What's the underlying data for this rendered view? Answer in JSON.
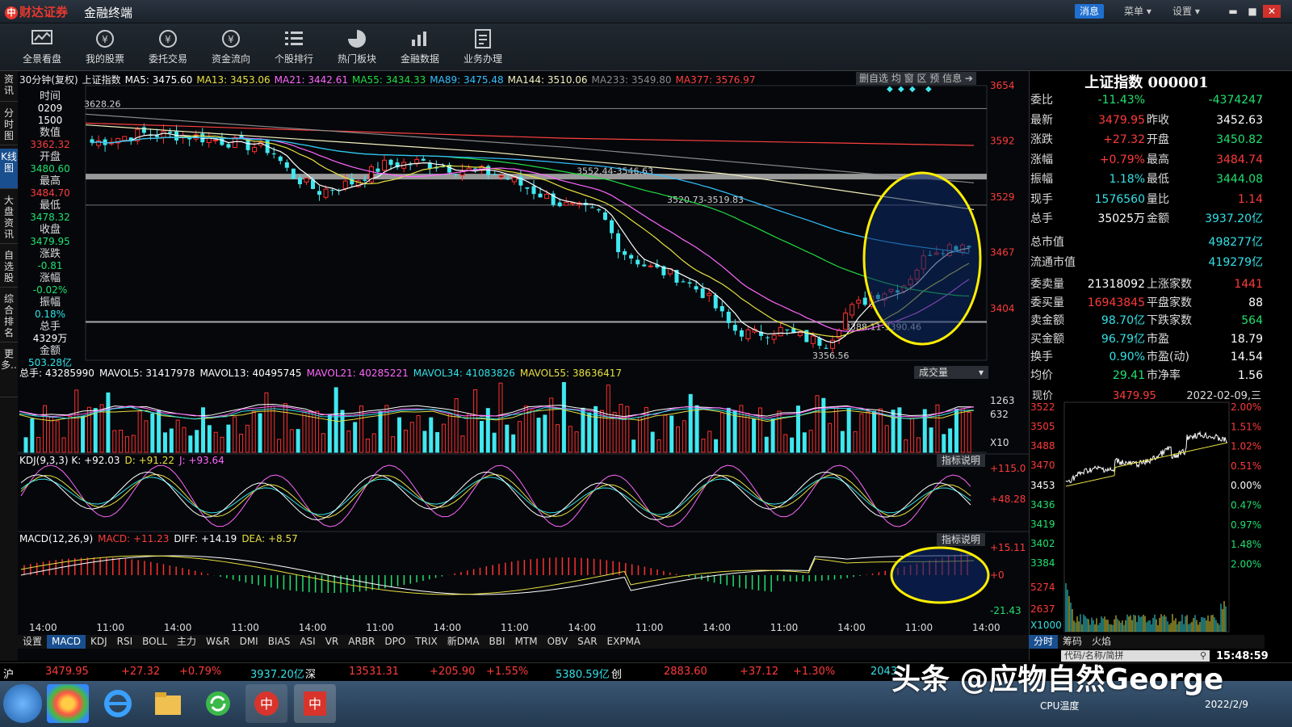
{
  "app": {
    "brand": "财达证券",
    "name": "金融终端",
    "messages": "消息",
    "menu": "菜单",
    "settings": "设置"
  },
  "toolbar": [
    "全景看盘",
    "我的股票",
    "委托交易",
    "资金流向",
    "个股排行",
    "热门板块",
    "金融数据",
    "业务办理"
  ],
  "left_tabs": [
    "资讯",
    "分时图",
    "K线图",
    "大盘资讯",
    "自选股",
    "综合排名",
    "更多.."
  ],
  "chart_header": {
    "period": "30分钟(复权)",
    "name": "上证指数",
    "ma": [
      {
        "label": "MA5: 3475.60",
        "color": "#ffffff"
      },
      {
        "label": "MA13: 3453.06",
        "color": "#e8e040"
      },
      {
        "label": "MA21: 3442.61",
        "color": "#ff66ff"
      },
      {
        "label": "MA55: 3434.33",
        "color": "#22dd44"
      },
      {
        "label": "MA89: 3475.48",
        "color": "#33c0ff"
      },
      {
        "label": "MA144: 3510.06",
        "color": "#f5f0c0"
      },
      {
        "label": "MA233: 3549.80",
        "color": "#8a8a8a"
      },
      {
        "label": "MA377: 3576.97",
        "color": "#ff4040"
      }
    ],
    "tools": "删自选 均 窗 区 预 信息"
  },
  "info_column": [
    {
      "label": "时间",
      "value": "0209",
      "vcolor": "#ffffff"
    },
    {
      "label": "",
      "value": "1500",
      "vcolor": "#ffffff"
    },
    {
      "label": "数值",
      "value": "3362.32",
      "vcolor": "#ff3b3b"
    },
    {
      "label": "开盘",
      "value": "3480.60",
      "vcolor": "#20e070"
    },
    {
      "label": "最高",
      "value": "3484.70",
      "vcolor": "#ff3b3b"
    },
    {
      "label": "最低",
      "value": "3478.32",
      "vcolor": "#20e070"
    },
    {
      "label": "收盘",
      "value": "3479.95",
      "vcolor": "#20e070"
    },
    {
      "label": "涨跌",
      "value": "-0.81",
      "vcolor": "#20e070"
    },
    {
      "label": "涨幅",
      "value": "-0.02%",
      "vcolor": "#20e070"
    },
    {
      "label": "振幅",
      "value": "0.18%",
      "vcolor": "#33e0e6"
    },
    {
      "label": "总手",
      "value": "4329万",
      "vcolor": "#ffffff"
    },
    {
      "label": "金额",
      "value": "503.28亿",
      "vcolor": "#33e0e6"
    }
  ],
  "kline": {
    "y_ticks": [
      "3654",
      "3592",
      "3529",
      "3467",
      "3404"
    ],
    "y_values": [
      3654,
      3592,
      3529,
      3467,
      3404
    ],
    "annotations": [
      {
        "text": "3628.26"
      },
      {
        "text": "3552.44-3546.63"
      },
      {
        "text": "3520.73-3519.83"
      },
      {
        "text": "3388.11-3390.46"
      },
      {
        "text": "3356.56"
      }
    ]
  },
  "volume": {
    "header": [
      {
        "label": "总手: 43285990",
        "color": "#ffffff"
      },
      {
        "label": "MAVOL5: 31417978",
        "color": "#ffffff"
      },
      {
        "label": "MAVOL13: 40495745",
        "color": "#ffffff"
      },
      {
        "label": "MAVOL21: 40285221",
        "color": "#ff66ff"
      },
      {
        "label": "MAVOL34: 41083826",
        "color": "#33e0e6"
      },
      {
        "label": "MAVOL55: 38636417",
        "color": "#e8e040"
      }
    ],
    "button": "成交量",
    "y_ticks": [
      "1263",
      "632",
      "X10"
    ]
  },
  "kdj": {
    "header": [
      {
        "label": "KDJ(9,3,3) K: +92.03",
        "color": "#ffffff"
      },
      {
        "label": "D: +91.22",
        "color": "#e8e040"
      },
      {
        "label": "J: +93.64",
        "color": "#ff66ff"
      }
    ],
    "button": "指标说明",
    "y_ticks": [
      "+115.0",
      "+48.28"
    ]
  },
  "macd": {
    "header": [
      {
        "label": "MACD(12,26,9)",
        "color": "#ffffff"
      },
      {
        "label": "MACD: +11.23",
        "color": "#ff3b3b"
      },
      {
        "label": "DIFF: +14.19",
        "color": "#ffffff"
      },
      {
        "label": "DEA: +8.57",
        "color": "#e8e040"
      }
    ],
    "button": "指标说明",
    "y_ticks": [
      "+15.11",
      "+0",
      "-21.43"
    ]
  },
  "x_ticks": [
    "14:00",
    "11:00",
    "14:00",
    "11:00",
    "14:00",
    "11:00",
    "14:00",
    "11:00",
    "14:00",
    "11:00",
    "14:00",
    "11:00",
    "14:00",
    "11:00",
    "14:00"
  ],
  "indicator_tabs": [
    "MACD",
    "KDJ",
    "RSI",
    "BOLL",
    "主力",
    "W&R",
    "DMI",
    "BIAS",
    "ASI",
    "VR",
    "ARBR",
    "DPO",
    "TRIX",
    "新DMA",
    "BBI",
    "MTM",
    "OBV",
    "SAR",
    "EXPMA"
  ],
  "quote": {
    "title": "上证指数 000001",
    "rows1": [
      [
        "委比",
        "-11.43%",
        "",
        "-4374247"
      ],
      [
        "最新",
        "3479.95",
        "昨收",
        "3452.63"
      ],
      [
        "涨跌",
        "+27.32",
        "开盘",
        "3450.82"
      ],
      [
        "涨幅",
        "+0.79%",
        "最高",
        "3484.74"
      ],
      [
        "振幅",
        "1.18%",
        "最低",
        "3444.08"
      ],
      [
        "现手",
        "1576560",
        "量比",
        "1.14"
      ],
      [
        "总手",
        "35025万",
        "金额",
        "3937.20亿"
      ]
    ],
    "rows2": [
      [
        "总市值",
        "498277亿"
      ],
      [
        "流通市值",
        "419279亿"
      ]
    ],
    "rows3": [
      [
        "委卖量",
        "21318092",
        "上涨家数",
        "1441"
      ],
      [
        "委买量",
        "16943845",
        "平盘家数",
        "88"
      ],
      [
        "卖金额",
        "98.70亿",
        "下跌家数",
        "564"
      ],
      [
        "买金额",
        "96.79亿",
        "市盈",
        "18.79"
      ],
      [
        "换手",
        "0.90%",
        "市盈(动)",
        "14.54"
      ],
      [
        "均价",
        "29.41",
        "市净率",
        "1.56"
      ]
    ],
    "mini": {
      "label": "现价",
      "price": "3479.95",
      "date": "2022-02-09,三",
      "y_left": [
        "3522",
        "3505",
        "3488",
        "3470",
        "3453",
        "3436",
        "3419",
        "3402",
        "3384",
        "5274",
        "2637",
        "X1000"
      ],
      "y_right": [
        "2.00%",
        "1.51%",
        "1.02%",
        "0.51%",
        "0.00%",
        "0.47%",
        "0.97%",
        "1.48%",
        "2.00%"
      ]
    },
    "tabs": [
      "分时",
      "筹码",
      "火焰"
    ],
    "search_placeholder": "代码/名称/简拼",
    "clock": "15:48:59"
  },
  "statusbar": [
    {
      "text": "沪",
      "color": "#ffffff"
    },
    {
      "text": "3479.95",
      "color": "#ff3b3b"
    },
    {
      "text": "+27.32",
      "color": "#ff3b3b"
    },
    {
      "text": "+0.79%",
      "color": "#ff3b3b"
    },
    {
      "text": "3937.20亿",
      "color": "#33e0e6"
    },
    {
      "text": "深",
      "color": "#ffffff"
    },
    {
      "text": "13531.31",
      "color": "#ff3b3b"
    },
    {
      "text": "+205.90",
      "color": "#ff3b3b"
    },
    {
      "text": "+1.55%",
      "color": "#ff3b3b"
    },
    {
      "text": "5380.59亿",
      "color": "#33e0e6"
    },
    {
      "text": "创",
      "color": "#ffffff"
    },
    {
      "text": "2883.60",
      "color": "#ff3b3b"
    },
    {
      "text": "+37.12",
      "color": "#ff3b3b"
    },
    {
      "text": "+1.30%",
      "color": "#ff3b3b"
    },
    {
      "text": "2043",
      "color": "#33e0e6"
    }
  ],
  "taskbar": {
    "cpu": "CPU温度",
    "date": "2022/2/9"
  },
  "watermark": "头条 @应物自然George"
}
